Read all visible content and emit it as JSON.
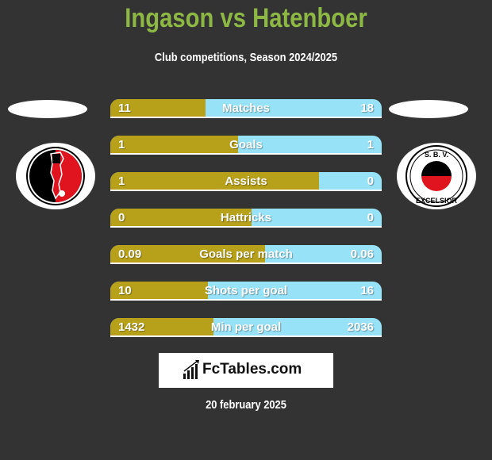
{
  "header": {
    "title": "Ingason vs Hatenboer",
    "subtitle": "Club competitions, Season 2024/2025"
  },
  "colors": {
    "title": "#8db843",
    "left_fill": "#b8a11a",
    "right_fill": "#98e2f8",
    "background": "#333333"
  },
  "players": {
    "left": {
      "name": "Ingason",
      "club_logo": "helmond-sport-crest-icon"
    },
    "right": {
      "name": "Hatenboer",
      "club_logo": "excelsior-crest-icon",
      "logo_text_top": "S. B. V.",
      "logo_text_bottom": "EXCELSIOR"
    }
  },
  "stats": [
    {
      "label": "Matches",
      "left": "11",
      "right": "18",
      "left_share": 0.35
    },
    {
      "label": "Goals",
      "left": "1",
      "right": "1",
      "left_share": 0.47
    },
    {
      "label": "Assists",
      "left": "1",
      "right": "0",
      "left_share": 0.77
    },
    {
      "label": "Hattricks",
      "left": "0",
      "right": "0",
      "left_share": 0.52
    },
    {
      "label": "Goals per match",
      "left": "0.09",
      "right": "0.06",
      "left_share": 0.57
    },
    {
      "label": "Shots per goal",
      "left": "10",
      "right": "16",
      "left_share": 0.36
    },
    {
      "label": "Min per goal",
      "left": "1432",
      "right": "2036",
      "left_share": 0.38
    }
  ],
  "brand": {
    "name": "FcTables.com",
    "icon": "bar-chart-icon"
  },
  "footer": {
    "date": "20 february 2025"
  }
}
